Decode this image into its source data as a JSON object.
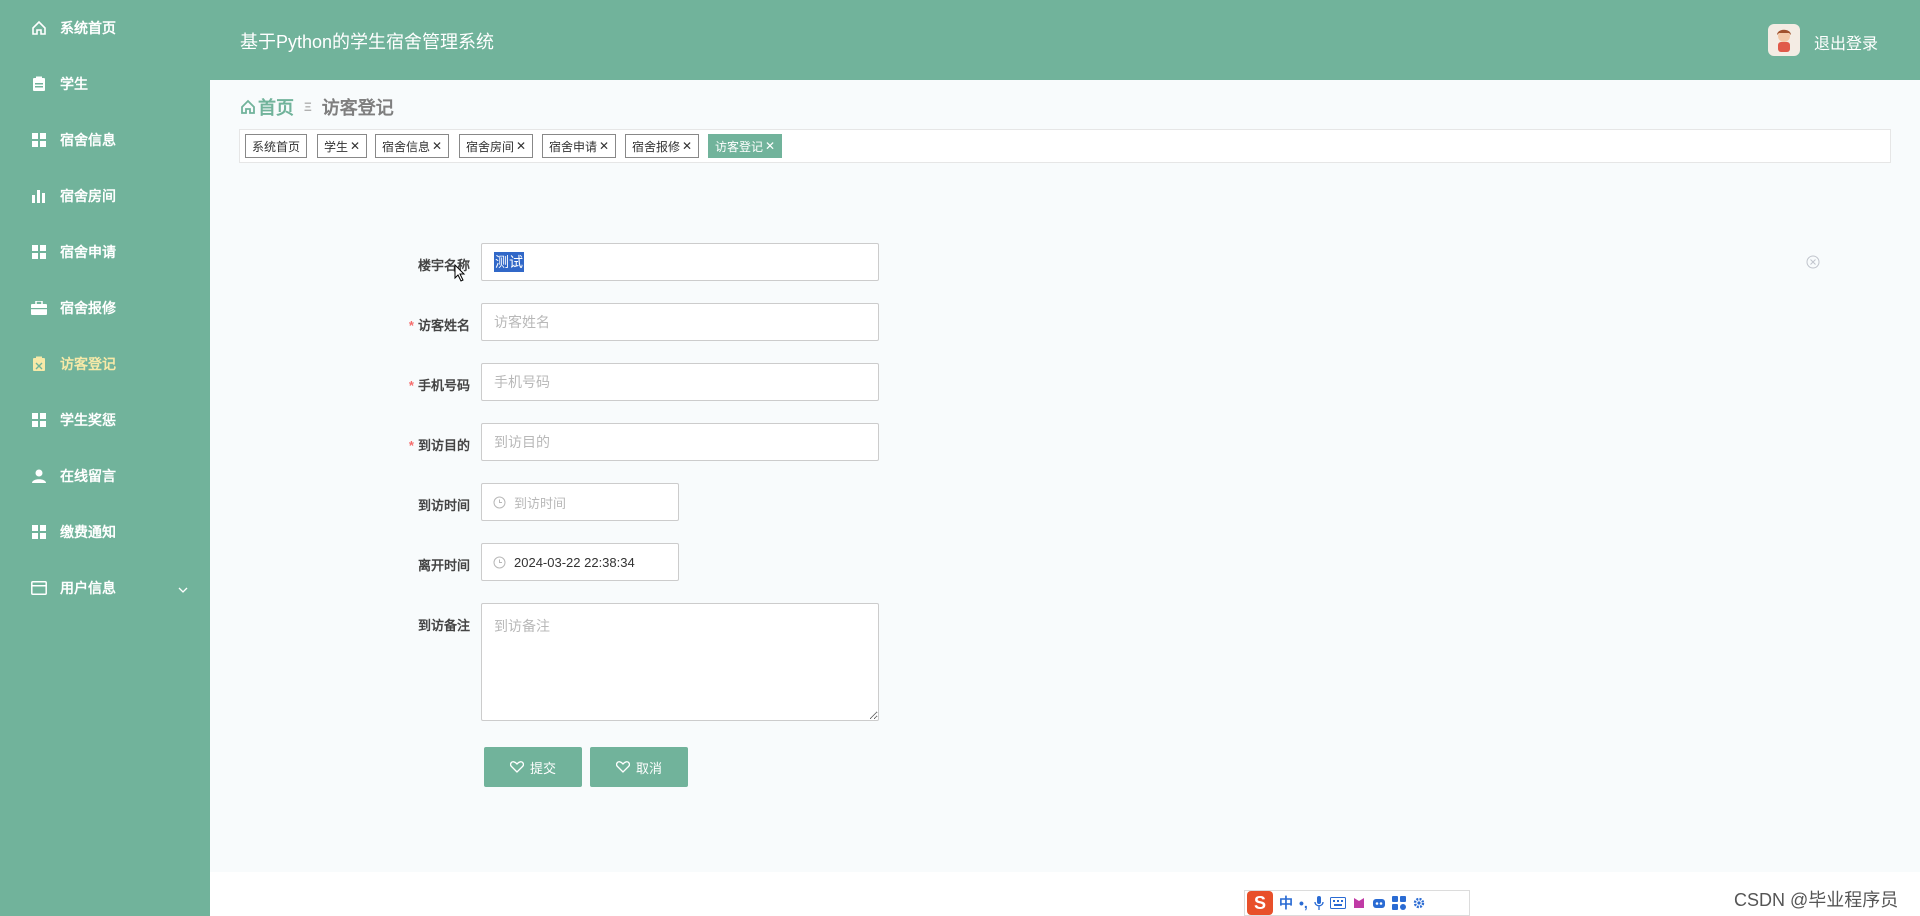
{
  "sidebar": {
    "items": [
      {
        "label": "系统首页",
        "icon": "home-icon"
      },
      {
        "label": "学生",
        "icon": "clipboard-icon"
      },
      {
        "label": "宿舍信息",
        "icon": "grid-icon"
      },
      {
        "label": "宿舍房间",
        "icon": "bar-chart-icon"
      },
      {
        "label": "宿舍申请",
        "icon": "grid-icon"
      },
      {
        "label": "宿舍报修",
        "icon": "briefcase-icon"
      },
      {
        "label": "访客登记",
        "icon": "clipboard-icon"
      },
      {
        "label": "学生奖惩",
        "icon": "grid-icon"
      },
      {
        "label": "在线留言",
        "icon": "user-icon"
      },
      {
        "label": "缴费通知",
        "icon": "grid-icon"
      },
      {
        "label": "用户信息",
        "icon": "card-icon"
      }
    ]
  },
  "header": {
    "title": "基于Python的学生宿舍管理系统",
    "logout": "退出登录"
  },
  "breadcrumb": {
    "home": "首页",
    "separator": "Ξ",
    "current": "访客登记"
  },
  "tags": [
    {
      "label": "系统首页",
      "closable": false
    },
    {
      "label": "学生",
      "closable": true
    },
    {
      "label": "宿舍信息",
      "closable": true
    },
    {
      "label": "宿舍房间",
      "closable": true
    },
    {
      "label": "宿舍申请",
      "closable": true
    },
    {
      "label": "宿舍报修",
      "closable": true
    },
    {
      "label": "访客登记",
      "closable": true,
      "active": true
    }
  ],
  "form": {
    "building": {
      "label": "楼宇名称",
      "value": "测试",
      "required": false
    },
    "visitor_name": {
      "label": "访客姓名",
      "placeholder": "访客姓名",
      "required": true
    },
    "phone": {
      "label": "手机号码",
      "placeholder": "手机号码",
      "required": true
    },
    "purpose": {
      "label": "到访目的",
      "placeholder": "到访目的",
      "required": true
    },
    "visit_time": {
      "label": "到访时间",
      "placeholder": "到访时间",
      "required": false
    },
    "leave_time": {
      "label": "离开时间",
      "value": "2024-03-22 22:38:34",
      "required": false
    },
    "remark": {
      "label": "到访备注",
      "placeholder": "到访备注",
      "required": false
    },
    "submit": "提交",
    "cancel": "取消"
  },
  "ime": {
    "mode": "中",
    "punct": "•,"
  },
  "watermark": "CSDN @毕业程序员",
  "colors": {
    "accent": "#71b39b",
    "required": "#f56c6c"
  }
}
